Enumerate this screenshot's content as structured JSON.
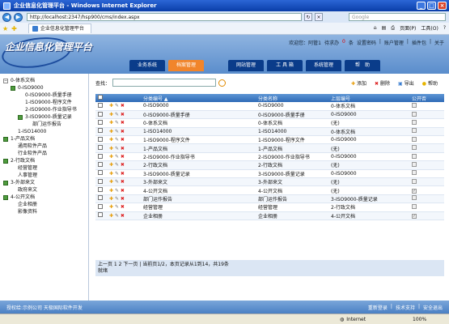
{
  "window": {
    "title": "企业信息化管理平台 - Windows Internet Explorer"
  },
  "browser": {
    "url": "http://localhost:2347/hsp900/cms/index.aspx",
    "search_placeholder": "Google",
    "tab_title": "企业信息化管理平台",
    "cmds": [
      "页面(P)",
      "工具(O)"
    ]
  },
  "app": {
    "logo": "企业信息化管理平台",
    "userbar": {
      "welcome": "欢迎您：阿管1",
      "todo_prefix": "待求办",
      "todo_count": "0",
      "todo_suffix": "条",
      "links": [
        "设置密码",
        "账户管理",
        "插件包",
        "关于"
      ]
    },
    "menu": [
      {
        "label": "业务系统",
        "active": false
      },
      {
        "label": "档案管理",
        "active": true
      },
      {
        "label": "网站管理",
        "active": false
      },
      {
        "label": "工 具 箱",
        "active": false
      },
      {
        "label": "系统管理",
        "active": false
      },
      {
        "label": "帮　助",
        "active": false
      }
    ]
  },
  "tree": [
    {
      "label": "0-体系文档",
      "level": 0,
      "mark": "minus"
    },
    {
      "label": "0-ISO9000",
      "level": 1,
      "mark": "green"
    },
    {
      "label": "0-ISO9000-质量手册",
      "level": 2,
      "mark": "none"
    },
    {
      "label": "1-ISO9000-程序文件",
      "level": 2,
      "mark": "none"
    },
    {
      "label": "2-ISO9000-作业指导书",
      "level": 2,
      "mark": "none"
    },
    {
      "label": "3-ISO9000-质量记录",
      "level": 2,
      "mark": "green"
    },
    {
      "label": "部门运作报告",
      "level": 3,
      "mark": "none"
    },
    {
      "label": "1-ISO14000",
      "level": 1,
      "mark": "none"
    },
    {
      "label": "1-产品文档",
      "level": 0,
      "mark": "green"
    },
    {
      "label": "通用软件产品",
      "level": 1,
      "mark": "none"
    },
    {
      "label": "行业软件产品",
      "level": 1,
      "mark": "none"
    },
    {
      "label": "2-行政文档",
      "level": 0,
      "mark": "green"
    },
    {
      "label": "经营管理",
      "level": 1,
      "mark": "none"
    },
    {
      "label": "人事管理",
      "level": 1,
      "mark": "none"
    },
    {
      "label": "3-外部来文",
      "level": 0,
      "mark": "green"
    },
    {
      "label": "政府来文",
      "level": 1,
      "mark": "none"
    },
    {
      "label": "4-公开文档",
      "level": 0,
      "mark": "green"
    },
    {
      "label": "企业相册",
      "level": 1,
      "mark": "none"
    },
    {
      "label": "影像资料",
      "level": 1,
      "mark": "none"
    }
  ],
  "query": {
    "label": "查找："
  },
  "actions": {
    "add": "添加",
    "delete": "删除",
    "export": "导出",
    "help": "帮助"
  },
  "table": {
    "headers": [
      "分类编号 ▲",
      "分类名称",
      "上层编号",
      "公开否"
    ],
    "rows": [
      [
        "0-ISO9000",
        "0-ISO9000",
        "0-体系文档",
        false
      ],
      [
        "0-ISO9000-质量手册",
        "0-ISO9000-质量手册",
        "0-ISO9000",
        false
      ],
      [
        "0-体系文档",
        "0-体系文档",
        "(无)",
        false
      ],
      [
        "1-ISO14000",
        "1-ISO14000",
        "0-体系文档",
        false
      ],
      [
        "1-ISO9000-程序文件",
        "1-ISO9000-程序文件",
        "0-ISO9000",
        false
      ],
      [
        "1-产品文档",
        "1-产品文档",
        "(无)",
        false
      ],
      [
        "2-ISO9000-作业指导书",
        "2-ISO9000-作业指导书",
        "0-ISO9000",
        false
      ],
      [
        "2-行政文档",
        "2-行政文档",
        "(无)",
        false
      ],
      [
        "3-ISO9000-质量记录",
        "3-ISO9000-质量记录",
        "0-ISO9000",
        false
      ],
      [
        "3-外部来文",
        "3-外部来文",
        "(无)",
        false
      ],
      [
        "4-公开文档",
        "4-公开文档",
        "(无)",
        true
      ],
      [
        "部门运作报告",
        "部门运作报告",
        "3-ISO9000-质量记录",
        false
      ],
      [
        "经营管理",
        "经营管理",
        "2-行政文档",
        false
      ],
      [
        "企业相册",
        "企业相册",
        "4-公开文档",
        true
      ]
    ]
  },
  "pager": {
    "line1": "上一页 1 2 下一页  | 当前页1/2，本页记录从1到14，共19条",
    "line2": "就绪"
  },
  "footer": {
    "left": "授权给:示例公司  天极国际软件开发",
    "right": [
      "重新登录",
      "技术支持",
      "安全退出"
    ]
  },
  "status": {
    "zone": "Internet",
    "zoom": "100%"
  }
}
